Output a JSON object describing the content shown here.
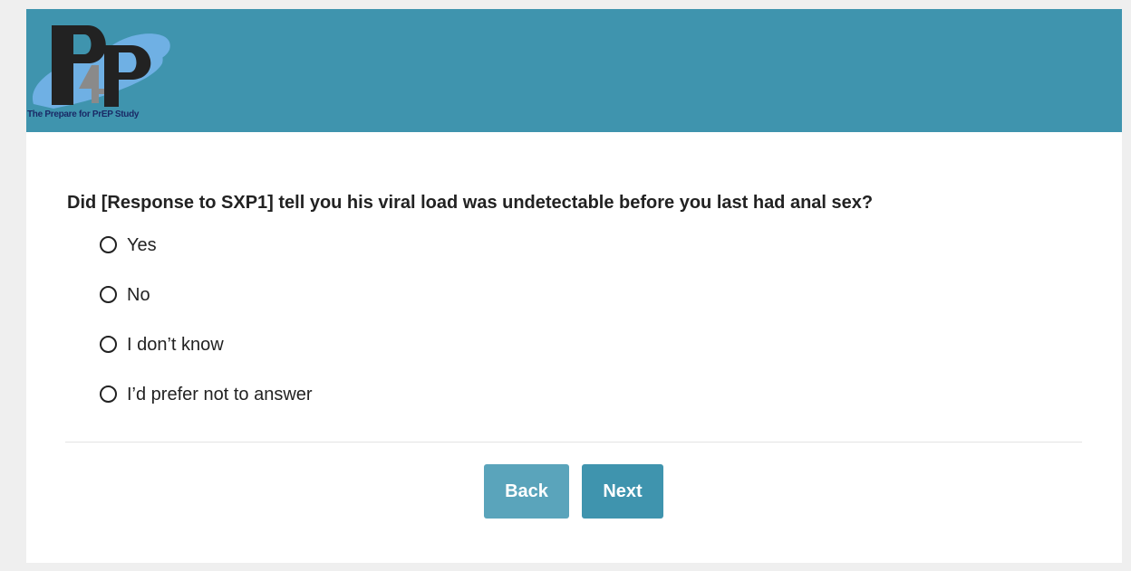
{
  "header": {
    "background_color": "#3f94ae",
    "logo": {
      "letters": "P4P",
      "tagline": "The Prepare for PrEP Study"
    }
  },
  "question": {
    "text": "Did [Response to SXP1] tell you his viral load was undetectable before you last had anal sex?",
    "options": [
      {
        "label": "Yes",
        "selected": false
      },
      {
        "label": "No",
        "selected": false
      },
      {
        "label": "I don’t know",
        "selected": false
      },
      {
        "label": "I’d prefer not to answer",
        "selected": false
      }
    ]
  },
  "navigation": {
    "back_label": "Back",
    "next_label": "Next",
    "back_color": "#5aa4bb",
    "next_color": "#3f94ae"
  },
  "icons": {
    "radio": "radio-unchecked-icon"
  }
}
